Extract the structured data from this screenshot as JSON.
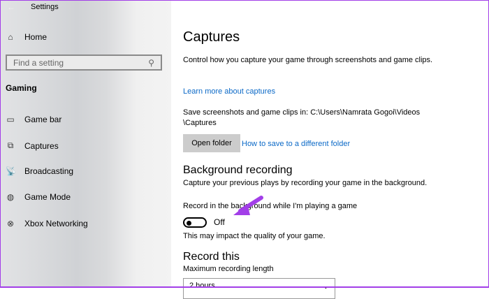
{
  "window": {
    "title": "Settings"
  },
  "sidebar": {
    "home": "Home",
    "search_placeholder": "Find a setting",
    "section": "Gaming",
    "items": [
      {
        "label": "Game bar",
        "icon": "game-bar-icon"
      },
      {
        "label": "Captures",
        "icon": "captures-icon"
      },
      {
        "label": "Broadcasting",
        "icon": "broadcasting-icon"
      },
      {
        "label": "Game Mode",
        "icon": "game-mode-icon"
      },
      {
        "label": "Xbox Networking",
        "icon": "xbox-icon"
      }
    ]
  },
  "main": {
    "title": "Captures",
    "description": "Control how you capture your game through screenshots and game clips.",
    "learn_more": "Learn more about captures",
    "save_location": "Save screenshots and game clips in: C:\\Users\\Namrata Gogoi\\Videos \\Captures",
    "open_folder": "Open folder",
    "how_to_save": "How to save to a different folder",
    "bg_heading": "Background recording",
    "bg_desc": "Capture your previous plays by recording your game in the background.",
    "bg_toggle_label": "Record in the background while I'm playing a game",
    "bg_toggle_state": "Off",
    "bg_note": "This may impact the quality of your game.",
    "record_heading": "Record this",
    "max_length_label": "Maximum recording length",
    "max_length_value": "2 hours"
  },
  "colors": {
    "accent": "#0b69c7",
    "annotation": "#a23ee8"
  }
}
